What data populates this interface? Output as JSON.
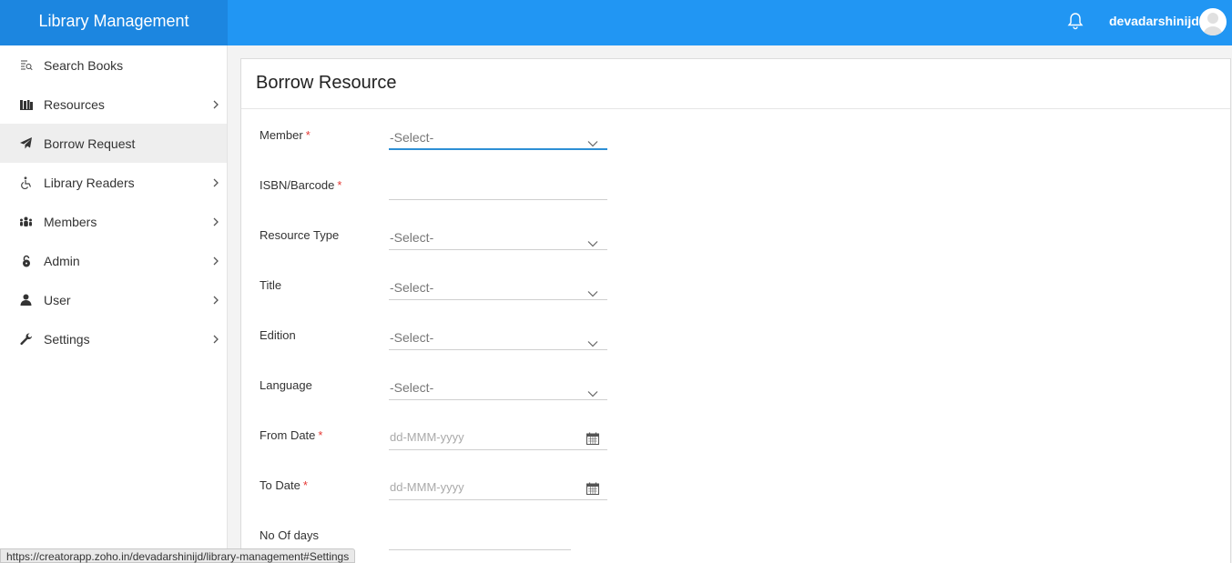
{
  "app": {
    "title": "Library Management",
    "username": "devadarshinijd",
    "accent": "#2196f3"
  },
  "sidebar": {
    "items": [
      {
        "label": "Search Books",
        "icon": "search-books-icon",
        "has_chevron": false
      },
      {
        "label": "Resources",
        "icon": "library-icon",
        "has_chevron": true
      },
      {
        "label": "Borrow Request",
        "icon": "paper-plane-icon",
        "has_chevron": false,
        "active": true
      },
      {
        "label": "Library Readers",
        "icon": "wheelchair-icon",
        "has_chevron": true
      },
      {
        "label": "Members",
        "icon": "members-icon",
        "has_chevron": true
      },
      {
        "label": "Admin",
        "icon": "lock-icon",
        "has_chevron": true
      },
      {
        "label": "User",
        "icon": "user-icon",
        "has_chevron": true
      },
      {
        "label": "Settings",
        "icon": "wrench-icon",
        "has_chevron": true
      }
    ]
  },
  "form": {
    "title": "Borrow Resource",
    "fields": [
      {
        "label": "Member",
        "required": true,
        "type": "select",
        "value": "-Select-"
      },
      {
        "label": "ISBN/Barcode",
        "required": true,
        "type": "text",
        "value": ""
      },
      {
        "label": "Resource Type",
        "required": false,
        "type": "select",
        "value": "-Select-"
      },
      {
        "label": "Title",
        "required": false,
        "type": "select",
        "value": "-Select-"
      },
      {
        "label": "Edition",
        "required": false,
        "type": "select",
        "value": "-Select-"
      },
      {
        "label": "Language",
        "required": false,
        "type": "select",
        "value": "-Select-"
      },
      {
        "label": "From Date",
        "required": true,
        "type": "date",
        "placeholder": "dd-MMM-yyyy"
      },
      {
        "label": "To Date",
        "required": true,
        "type": "date",
        "placeholder": "dd-MMM-yyyy"
      },
      {
        "label": "No Of days",
        "required": false,
        "type": "text",
        "value": ""
      }
    ]
  },
  "statusbar": {
    "url": "https://creatorapp.zoho.in/devadarshinijd/library-management#Settings"
  }
}
